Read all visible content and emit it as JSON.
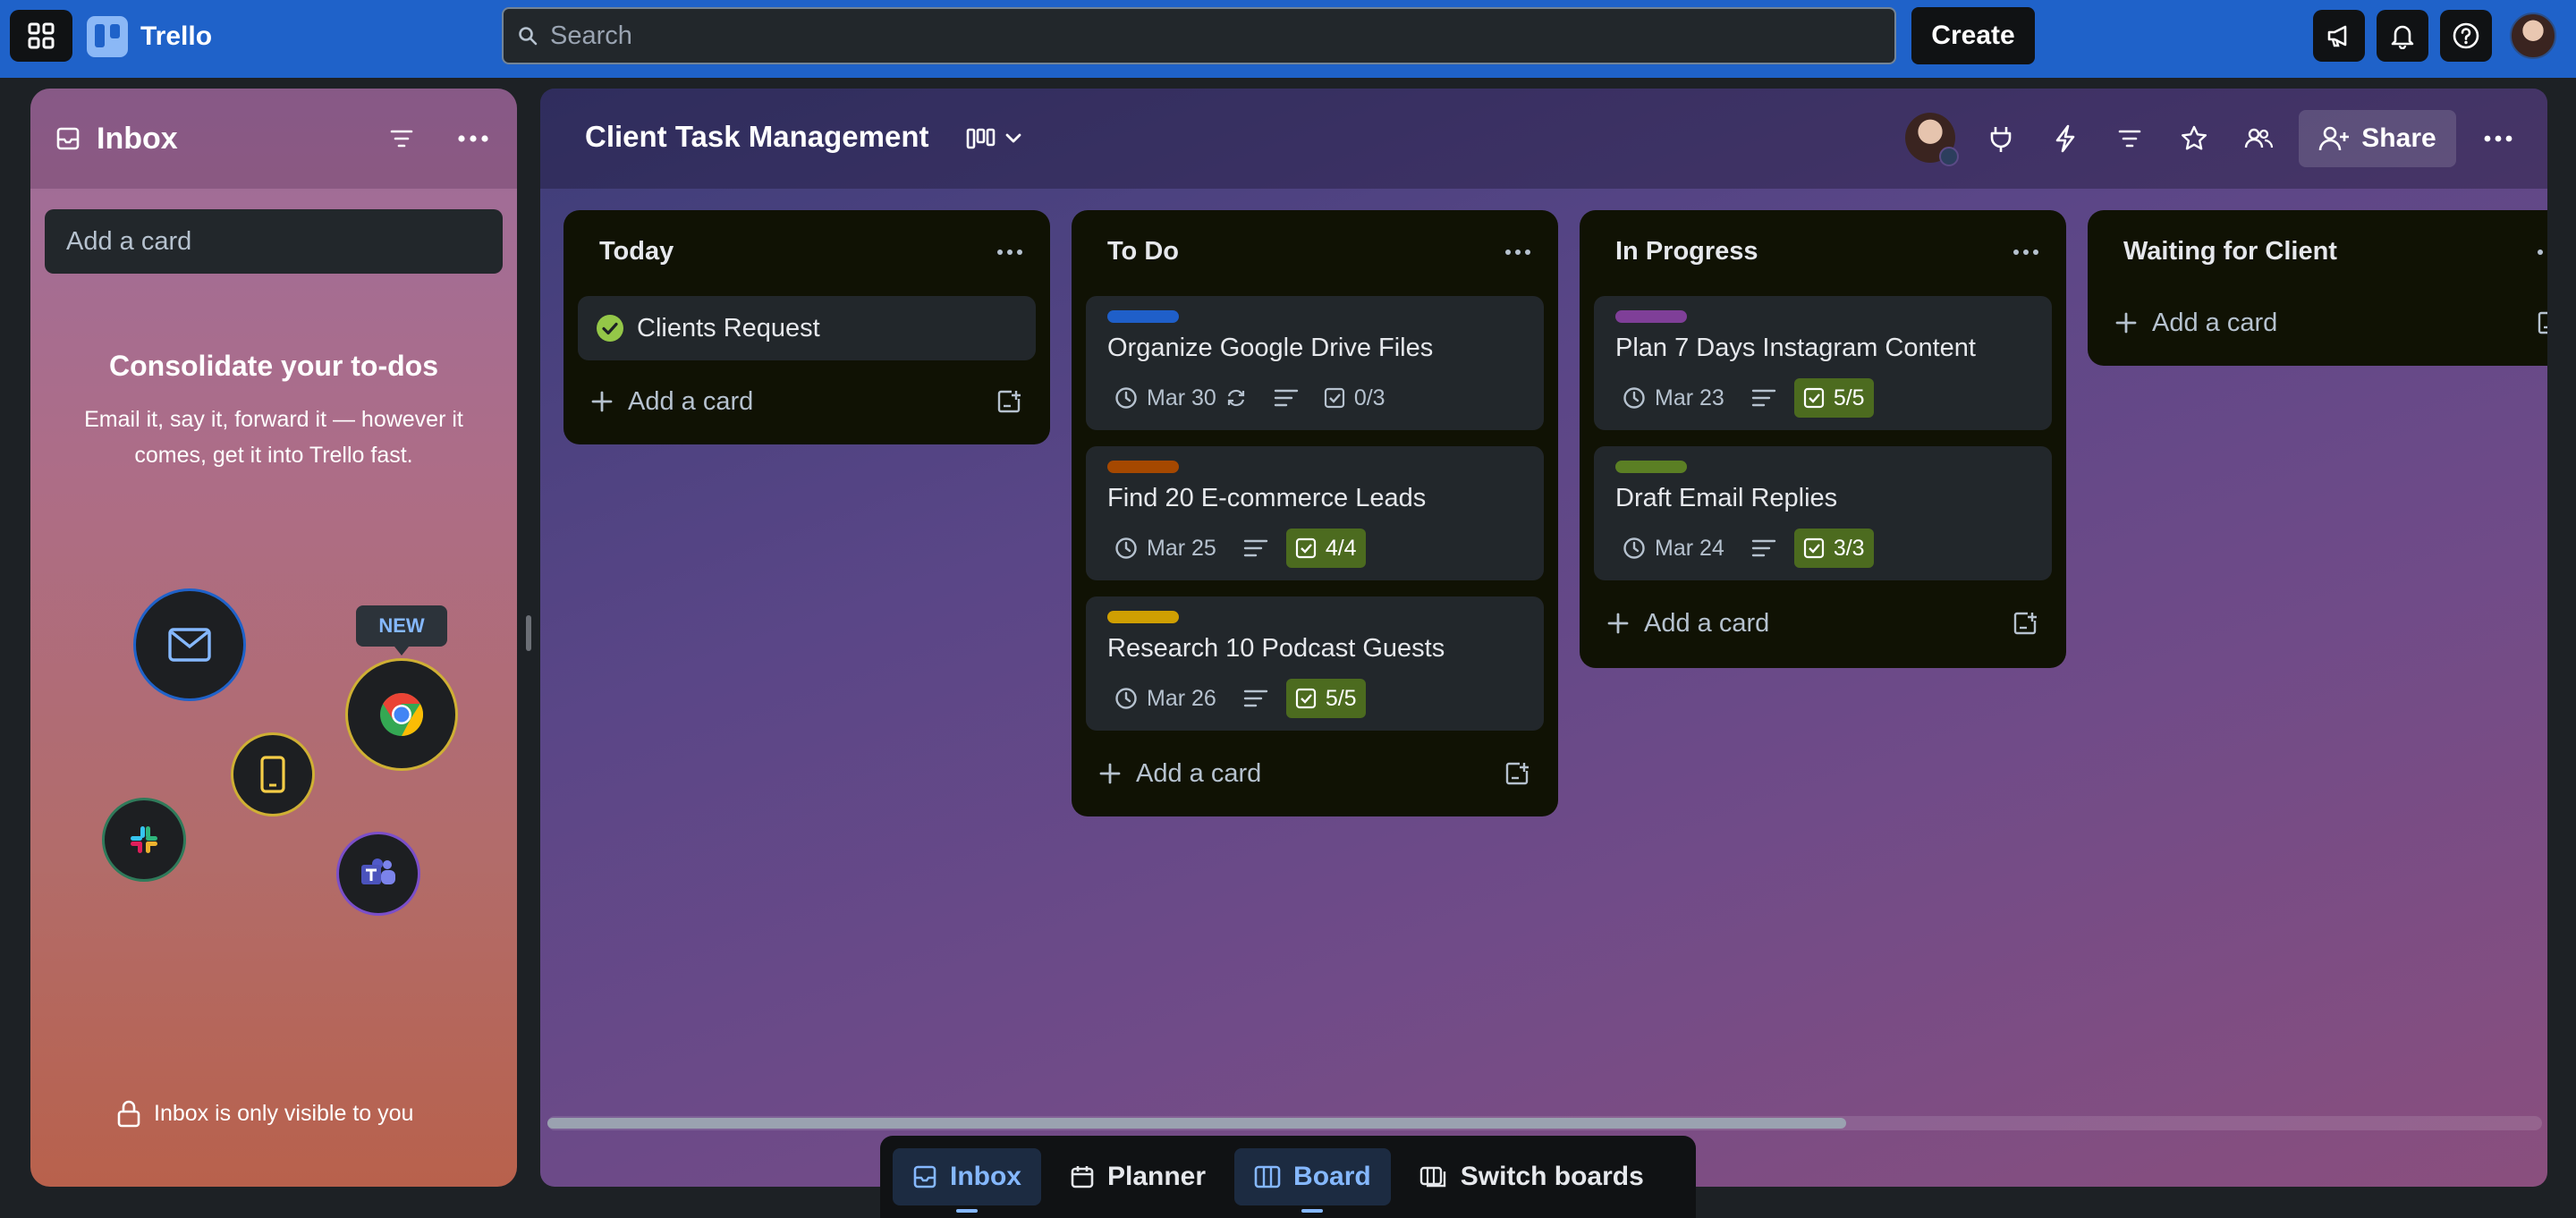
{
  "app": {
    "name": "Trello"
  },
  "search": {
    "placeholder": "Search"
  },
  "topbar": {
    "create_label": "Create"
  },
  "inbox": {
    "title": "Inbox",
    "add_card_placeholder": "Add a card",
    "promo_title": "Consolidate your to-dos",
    "promo_desc": "Email it, say it, forward it — however it comes, get it into Trello fast.",
    "new_badge": "NEW",
    "privacy_note": "Inbox is only visible to you"
  },
  "board": {
    "title": "Client Task Management",
    "share_label": "Share",
    "lists": [
      {
        "title": "Today",
        "cards": [
          {
            "title": "Clients Request",
            "completed": true
          }
        ],
        "add_label": "Add a card"
      },
      {
        "title": "To Do",
        "cards": [
          {
            "title": "Organize Google Drive Files",
            "label_color": "#1f5fc9",
            "due": "Mar 30",
            "checklist": "0/3",
            "checklist_complete": false,
            "recurring": true
          },
          {
            "title": "Find 20 E-commerce Leads",
            "label_color": "#a54800",
            "due": "Mar 25",
            "checklist": "4/4",
            "checklist_complete": true
          },
          {
            "title": "Research 10 Podcast Guests",
            "label_color": "#cf9f02",
            "due": "Mar 26",
            "checklist": "5/5",
            "checklist_complete": true
          }
        ],
        "add_label": "Add a card"
      },
      {
        "title": "In Progress",
        "cards": [
          {
            "title": "Plan 7 Days Instagram Content",
            "label_color": "#7f3f98",
            "due": "Mar 23",
            "checklist": "5/5",
            "checklist_complete": true
          },
          {
            "title": "Draft Email Replies",
            "label_color": "#5b7f24",
            "due": "Mar 24",
            "checklist": "3/3",
            "checklist_complete": true
          }
        ],
        "add_label": "Add a card"
      },
      {
        "title": "Waiting for Client",
        "cards": [],
        "add_label": "Add a card"
      }
    ]
  },
  "switcher": {
    "inbox": "Inbox",
    "planner": "Planner",
    "board": "Board",
    "switch_boards": "Switch boards"
  },
  "colors": {
    "topbar": "#1f62c9",
    "list_bg": "#101204",
    "card_bg": "#22272b",
    "checklist_done": "#4c6b1f",
    "active_accent": "#85b8ff"
  }
}
